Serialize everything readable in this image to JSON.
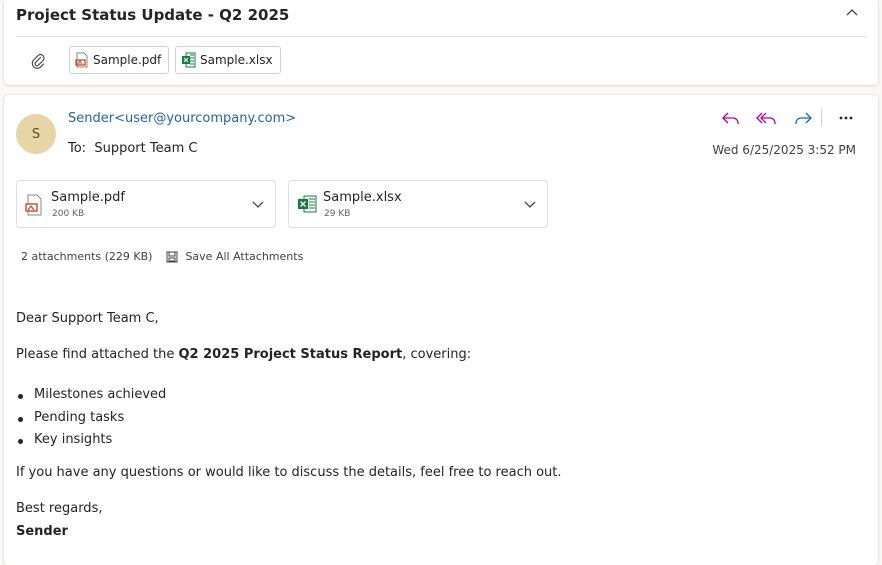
{
  "subject": "Project Status Update - Q2 2025",
  "header_attachments": [
    {
      "name": "Sample.pdf",
      "type": "pdf"
    },
    {
      "name": "Sample.xlsx",
      "type": "xlsx"
    }
  ],
  "message": {
    "avatar_initial": "S",
    "sender": "Sender<user@yourcompany.com>",
    "to_label": "To:",
    "to_value": "Support Team C",
    "date": "Wed 6/25/2025 3:52 PM",
    "attachments": [
      {
        "name": "Sample.pdf",
        "size": "200 KB",
        "type": "pdf"
      },
      {
        "name": "Sample.xlsx",
        "size": "29 KB",
        "type": "xlsx"
      }
    ],
    "attachments_summary": "2 attachments (229 KB)",
    "save_all_label": "Save All Attachments"
  },
  "body": {
    "greeting": "Dear Support Team C,",
    "intro_prefix": "Please find attached the ",
    "intro_bold": "Q2 2025 Project Status Report",
    "intro_suffix": ", covering:",
    "bullets": [
      "Milestones achieved",
      "Pending tasks",
      "Key insights"
    ],
    "closing_line": "If you have any questions or would like to discuss the details, feel free to reach out.",
    "signoff": "Best regards,",
    "signature": "Sender"
  },
  "colors": {
    "sender_link": "#2266a6",
    "reply_icons": "#b4009e",
    "forward_icon": "#0f6cbd",
    "avatar_bg": "#e6d6a7",
    "pdf_red": "#c43e1c",
    "excel_green": "#107c41"
  }
}
